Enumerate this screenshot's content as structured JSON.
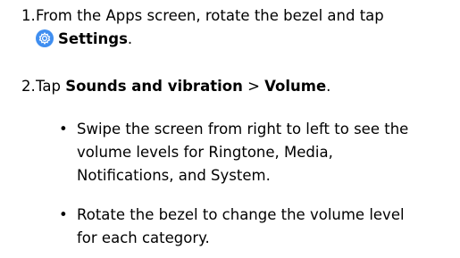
{
  "steps": [
    {
      "number": "1.",
      "line1": "From the Apps screen, rotate the bezel and tap",
      "app_name": "Settings",
      "suffix": "."
    },
    {
      "number": "2.",
      "prefix": "Tap ",
      "sounds_label": "Sounds and vibration",
      "separator": " > ",
      "volume_label": "Volume",
      "suffix": "."
    }
  ],
  "bullets": [
    {
      "marker": "•",
      "lines": [
        "Swipe the screen from right to left to see the",
        "volume levels for Ringtone, Media,",
        "Notifications, and System."
      ]
    },
    {
      "marker": "•",
      "lines": [
        "Rotate the bezel to change the volume level",
        "for each category."
      ]
    }
  ],
  "icons": {
    "settings": "gear-icon",
    "settings_color": "#3f8ef0"
  }
}
